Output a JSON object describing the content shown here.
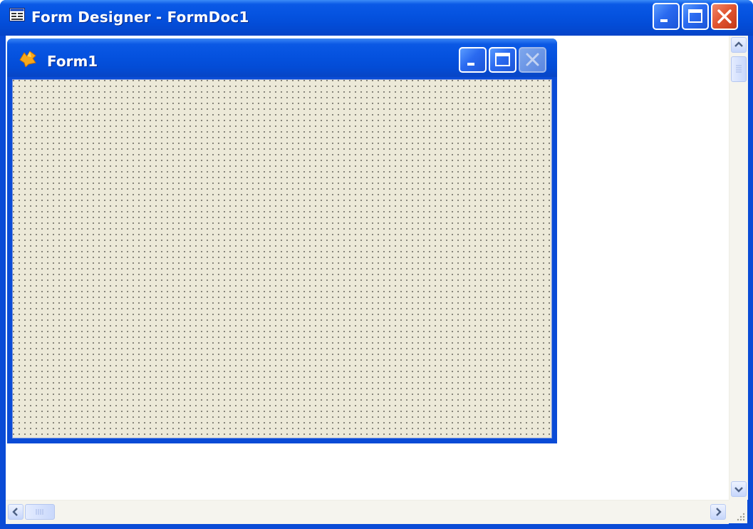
{
  "window": {
    "title": "Form Designer - FormDoc1",
    "icon": "form-designer-icon",
    "frame_color": "#0a4bd6",
    "controls": [
      "minimize",
      "maximize",
      "close"
    ]
  },
  "form": {
    "title": "Form1",
    "icon": "fox-icon",
    "controls": [
      "minimize",
      "maximize",
      "close"
    ],
    "close_enabled": false,
    "grid_color": "#ece9d8"
  },
  "scrollbars": {
    "vertical": true,
    "horizontal": true
  }
}
